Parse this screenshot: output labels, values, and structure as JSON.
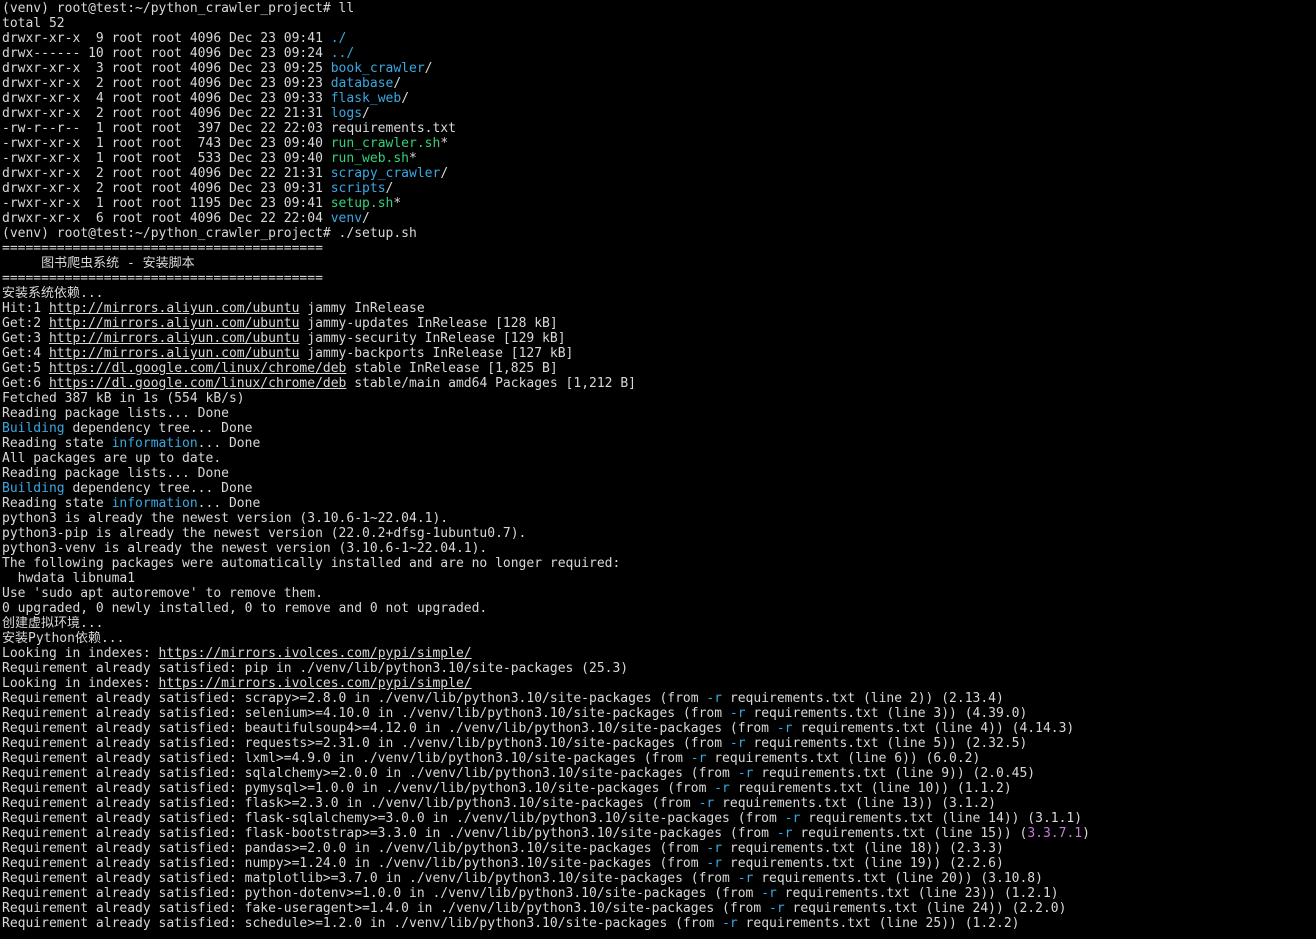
{
  "terminal": {
    "colors": {
      "background": "#000000",
      "foreground": "#d8d8d8",
      "directory": "#3ba7e0",
      "executable": "#33d17a",
      "highlight": "#c679dd"
    },
    "lines": [
      [
        {
          "t": "(venv) root@test:~/python_crawler_project# ll"
        }
      ],
      [
        {
          "t": "total 52"
        }
      ],
      [
        {
          "t": "drwxr-xr-x  9 root root 4096 Dec 23 09:41 "
        },
        {
          "t": "./",
          "c": "blue"
        }
      ],
      [
        {
          "t": "drwx------ 10 root root 4096 Dec 23 09:24 "
        },
        {
          "t": "../",
          "c": "blue"
        }
      ],
      [
        {
          "t": "drwxr-xr-x  3 root root 4096 Dec 23 09:25 "
        },
        {
          "t": "book_crawler",
          "c": "blue"
        },
        {
          "t": "/"
        }
      ],
      [
        {
          "t": "drwxr-xr-x  2 root root 4096 Dec 23 09:23 "
        },
        {
          "t": "database",
          "c": "blue"
        },
        {
          "t": "/"
        }
      ],
      [
        {
          "t": "drwxr-xr-x  4 root root 4096 Dec 23 09:33 "
        },
        {
          "t": "flask_web",
          "c": "blue"
        },
        {
          "t": "/"
        }
      ],
      [
        {
          "t": "drwxr-xr-x  2 root root 4096 Dec 22 21:31 "
        },
        {
          "t": "logs",
          "c": "blue"
        },
        {
          "t": "/"
        }
      ],
      [
        {
          "t": "-rw-r--r--  1 root root  397 Dec 22 22:03 requirements.txt"
        }
      ],
      [
        {
          "t": "-rwxr-xr-x  1 root root  743 Dec 23 09:40 "
        },
        {
          "t": "run_crawler.sh",
          "c": "green"
        },
        {
          "t": "*"
        }
      ],
      [
        {
          "t": "-rwxr-xr-x  1 root root  533 Dec 23 09:40 "
        },
        {
          "t": "run_web.sh",
          "c": "green"
        },
        {
          "t": "*"
        }
      ],
      [
        {
          "t": "drwxr-xr-x  2 root root 4096 Dec 22 21:31 "
        },
        {
          "t": "scrapy_crawler",
          "c": "blue"
        },
        {
          "t": "/"
        }
      ],
      [
        {
          "t": "drwxr-xr-x  2 root root 4096 Dec 23 09:31 "
        },
        {
          "t": "scripts",
          "c": "blue"
        },
        {
          "t": "/"
        }
      ],
      [
        {
          "t": "-rwxr-xr-x  1 root root 1195 Dec 23 09:41 "
        },
        {
          "t": "setup.sh",
          "c": "green"
        },
        {
          "t": "*"
        }
      ],
      [
        {
          "t": "drwxr-xr-x  6 root root 4096 Dec 22 22:04 "
        },
        {
          "t": "venv",
          "c": "blue"
        },
        {
          "t": "/"
        }
      ],
      [
        {
          "t": "(venv) root@test:~/python_crawler_project# ./setup.sh"
        }
      ],
      [
        {
          "t": "========================================="
        }
      ],
      [
        {
          "t": "     图书爬虫系统 - 安装脚本"
        }
      ],
      [
        {
          "t": "========================================="
        }
      ],
      [
        {
          "t": "安装系统依赖..."
        }
      ],
      [
        {
          "t": "Hit:1 "
        },
        {
          "t": "http://mirrors.aliyun.com/ubuntu",
          "c": "link"
        },
        {
          "t": " jammy InRelease"
        }
      ],
      [
        {
          "t": "Get:2 "
        },
        {
          "t": "http://mirrors.aliyun.com/ubuntu",
          "c": "link"
        },
        {
          "t": " jammy-updates InRelease [128 kB]"
        }
      ],
      [
        {
          "t": "Get:3 "
        },
        {
          "t": "http://mirrors.aliyun.com/ubuntu",
          "c": "link"
        },
        {
          "t": " jammy-security InRelease [129 kB]"
        }
      ],
      [
        {
          "t": "Get:4 "
        },
        {
          "t": "http://mirrors.aliyun.com/ubuntu",
          "c": "link"
        },
        {
          "t": " jammy-backports InRelease [127 kB]"
        }
      ],
      [
        {
          "t": "Get:5 "
        },
        {
          "t": "https://dl.google.com/linux/chrome/deb",
          "c": "link"
        },
        {
          "t": " stable InRelease [1,825 B]"
        }
      ],
      [
        {
          "t": "Get:6 "
        },
        {
          "t": "https://dl.google.com/linux/chrome/deb",
          "c": "link"
        },
        {
          "t": " stable/main amd64 Packages [1,212 B]"
        }
      ],
      [
        {
          "t": "Fetched 387 kB in 1s (554 kB/s)"
        }
      ],
      [
        {
          "t": "Reading package lists... Done"
        }
      ],
      [
        {
          "t": "Building",
          "c": "blue"
        },
        {
          "t": " dependency tree... Done"
        }
      ],
      [
        {
          "t": "Reading state "
        },
        {
          "t": "information",
          "c": "blue"
        },
        {
          "t": "... Done"
        }
      ],
      [
        {
          "t": "All packages are up to date."
        }
      ],
      [
        {
          "t": "Reading package lists... Done"
        }
      ],
      [
        {
          "t": "Building",
          "c": "blue"
        },
        {
          "t": " dependency tree... Done"
        }
      ],
      [
        {
          "t": "Reading state "
        },
        {
          "t": "information",
          "c": "blue"
        },
        {
          "t": "... Done"
        }
      ],
      [
        {
          "t": "python3 is already the newest version (3.10.6-1~22.04.1)."
        }
      ],
      [
        {
          "t": "python3-pip is already the newest version (22.0.2+dfsg-1ubuntu0.7)."
        }
      ],
      [
        {
          "t": "python3-venv is already the newest version (3.10.6-1~22.04.1)."
        }
      ],
      [
        {
          "t": "The following packages were automatically installed and are no longer required:"
        }
      ],
      [
        {
          "t": "  hwdata libnuma1"
        }
      ],
      [
        {
          "t": "Use 'sudo apt autoremove' to remove them."
        }
      ],
      [
        {
          "t": "0 upgraded, 0 newly installed, 0 to remove and 0 not upgraded."
        }
      ],
      [
        {
          "t": "创建虚拟环境..."
        }
      ],
      [
        {
          "t": "安装Python依赖..."
        }
      ],
      [
        {
          "t": "Looking in indexes: "
        },
        {
          "t": "https://mirrors.ivolces.com/pypi/simple/",
          "c": "link"
        }
      ],
      [
        {
          "t": "Requirement already satisfied: pip in ./venv/lib/python3.10/site-packages (25.3)"
        }
      ],
      [
        {
          "t": "Looking in indexes: "
        },
        {
          "t": "https://mirrors.ivolces.com/pypi/simple/",
          "c": "link"
        }
      ],
      [
        {
          "t": "Requirement already satisfied: scrapy>=2.8.0 in ./venv/lib/python3.10/site-packages (from "
        },
        {
          "t": "-r",
          "c": "blue"
        },
        {
          "t": " requirements.txt (line 2)) (2.13.4)"
        }
      ],
      [
        {
          "t": "Requirement already satisfied: selenium>=4.10.0 in ./venv/lib/python3.10/site-packages (from "
        },
        {
          "t": "-r",
          "c": "blue"
        },
        {
          "t": " requirements.txt (line 3)) (4.39.0)"
        }
      ],
      [
        {
          "t": "Requirement already satisfied: beautifulsoup4>=4.12.0 in ./venv/lib/python3.10/site-packages (from "
        },
        {
          "t": "-r",
          "c": "blue"
        },
        {
          "t": " requirements.txt (line 4)) (4.14.3)"
        }
      ],
      [
        {
          "t": "Requirement already satisfied: requests>=2.31.0 in ./venv/lib/python3.10/site-packages (from "
        },
        {
          "t": "-r",
          "c": "blue"
        },
        {
          "t": " requirements.txt (line 5)) (2.32.5)"
        }
      ],
      [
        {
          "t": "Requirement already satisfied: lxml>=4.9.0 in ./venv/lib/python3.10/site-packages (from "
        },
        {
          "t": "-r",
          "c": "blue"
        },
        {
          "t": " requirements.txt (line 6)) (6.0.2)"
        }
      ],
      [
        {
          "t": "Requirement already satisfied: sqlalchemy>=2.0.0 in ./venv/lib/python3.10/site-packages (from "
        },
        {
          "t": "-r",
          "c": "blue"
        },
        {
          "t": " requirements.txt (line 9)) (2.0.45)"
        }
      ],
      [
        {
          "t": "Requirement already satisfied: pymysql>=1.0.0 in ./venv/lib/python3.10/site-packages (from "
        },
        {
          "t": "-r",
          "c": "blue"
        },
        {
          "t": " requirements.txt (line 10)) (1.1.2)"
        }
      ],
      [
        {
          "t": "Requirement already satisfied: flask>=2.3.0 in ./venv/lib/python3.10/site-packages (from "
        },
        {
          "t": "-r",
          "c": "blue"
        },
        {
          "t": " requirements.txt (line 13)) (3.1.2)"
        }
      ],
      [
        {
          "t": "Requirement already satisfied: flask-sqlalchemy>=3.0.0 in ./venv/lib/python3.10/site-packages (from "
        },
        {
          "t": "-r",
          "c": "blue"
        },
        {
          "t": " requirements.txt (line 14)) (3.1.1)"
        }
      ],
      [
        {
          "t": "Requirement already satisfied: flask-bootstrap>=3.3.0 in ./venv/lib/python3.10/site-packages (from "
        },
        {
          "t": "-r",
          "c": "blue"
        },
        {
          "t": " requirements.txt (line 15)) ("
        },
        {
          "t": "3.3.7.1",
          "c": "magenta"
        },
        {
          "t": ")"
        }
      ],
      [
        {
          "t": "Requirement already satisfied: pandas>=2.0.0 in ./venv/lib/python3.10/site-packages (from "
        },
        {
          "t": "-r",
          "c": "blue"
        },
        {
          "t": " requirements.txt (line 18)) (2.3.3)"
        }
      ],
      [
        {
          "t": "Requirement already satisfied: numpy>=1.24.0 in ./venv/lib/python3.10/site-packages (from "
        },
        {
          "t": "-r",
          "c": "blue"
        },
        {
          "t": " requirements.txt (line 19)) (2.2.6)"
        }
      ],
      [
        {
          "t": "Requirement already satisfied: matplotlib>=3.7.0 in ./venv/lib/python3.10/site-packages (from "
        },
        {
          "t": "-r",
          "c": "blue"
        },
        {
          "t": " requirements.txt (line 20)) (3.10.8)"
        }
      ],
      [
        {
          "t": "Requirement already satisfied: python-dotenv>=1.0.0 in ./venv/lib/python3.10/site-packages (from "
        },
        {
          "t": "-r",
          "c": "blue"
        },
        {
          "t": " requirements.txt (line 23)) (1.2.1)"
        }
      ],
      [
        {
          "t": "Requirement already satisfied: fake-useragent>=1.4.0 in ./venv/lib/python3.10/site-packages (from "
        },
        {
          "t": "-r",
          "c": "blue"
        },
        {
          "t": " requirements.txt (line 24)) (2.2.0)"
        }
      ],
      [
        {
          "t": "Requirement already satisfied: schedule>=1.2.0 in ./venv/lib/python3.10/site-packages (from "
        },
        {
          "t": "-r",
          "c": "blue"
        },
        {
          "t": " requirements.txt (line 25)) (1.2.2)"
        }
      ]
    ]
  }
}
